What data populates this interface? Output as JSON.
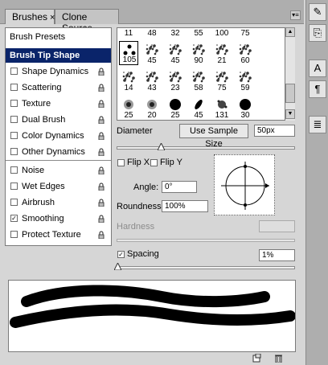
{
  "tabs": [
    {
      "label": "Brushes",
      "close": "×"
    },
    {
      "label": "Clone Source"
    }
  ],
  "dock": {
    "icons": [
      "brush-preset-icon",
      "clone-source-icon",
      "character-icon",
      "paragraph-icon",
      "notes-icon"
    ],
    "glyphs": [
      "✎",
      "⎘",
      "A",
      "¶",
      "≣"
    ]
  },
  "list": {
    "heading": "Brush Presets",
    "selected": "Brush Tip Shape",
    "options_a": [
      {
        "label": "Shape Dynamics",
        "checked": false
      },
      {
        "label": "Scattering",
        "checked": false
      },
      {
        "label": "Texture",
        "checked": false
      },
      {
        "label": "Dual Brush",
        "checked": false
      },
      {
        "label": "Color Dynamics",
        "checked": false
      },
      {
        "label": "Other Dynamics",
        "checked": false
      }
    ],
    "options_b": [
      {
        "label": "Noise",
        "checked": false
      },
      {
        "label": "Wet Edges",
        "checked": false
      },
      {
        "label": "Airbrush",
        "checked": false
      },
      {
        "label": "Smoothing",
        "checked": true
      },
      {
        "label": "Protect Texture",
        "checked": false
      }
    ],
    "checkmark": "✓"
  },
  "brush_grid": {
    "rows": [
      [
        "11",
        "48",
        "32",
        "55",
        "100",
        "75",
        "",
        ""
      ],
      [
        "105",
        "45",
        "45",
        "90",
        "21",
        "60",
        "",
        ""
      ],
      [
        "14",
        "43",
        "23",
        "58",
        "75",
        "59",
        "",
        ""
      ],
      [
        "25",
        "20",
        "25",
        "45",
        "131",
        "30",
        "",
        ""
      ]
    ],
    "selected": "105"
  },
  "diameter": {
    "label": "Diameter",
    "button": "Use Sample Size",
    "value": "50px"
  },
  "flip": {
    "x_label": "Flip X",
    "y_label": "Flip Y"
  },
  "angle": {
    "label": "Angle:",
    "value": "0°"
  },
  "roundness": {
    "label": "Roundness:",
    "value": "100%"
  },
  "hardness": {
    "label": "Hardness",
    "value": ""
  },
  "spacing": {
    "label": "Spacing",
    "checked": true,
    "value": "1%"
  },
  "footer_icons": [
    "new-brush-icon",
    "delete-brush-icon"
  ]
}
